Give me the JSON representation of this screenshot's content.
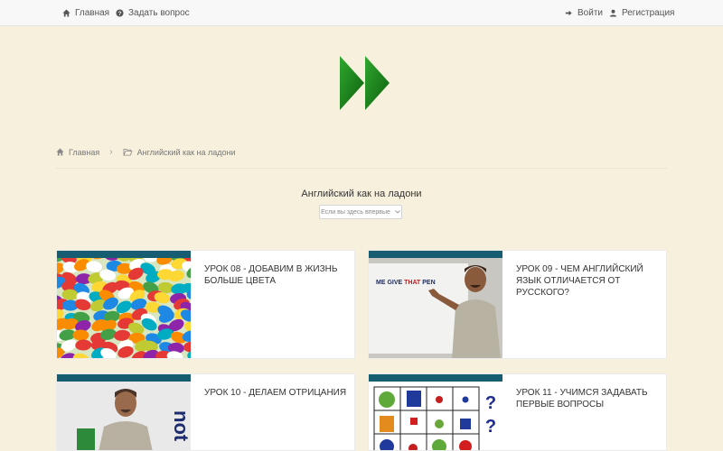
{
  "nav": {
    "home": "Главная",
    "ask": "Задать вопрос",
    "login": "Войти",
    "register": "Регистрация"
  },
  "breadcrumb": {
    "home": "Главная",
    "current": "Английский как на ладони"
  },
  "page": {
    "title": "Английский как на ладони",
    "select_value": "Если вы здесь впервые"
  },
  "lessons": [
    {
      "title": "Урок 08 - Добавим в жизнь больше цвета",
      "thumb": "colorful-candies"
    },
    {
      "title": "Урок 09 - Чем английский язык отличается от русского?",
      "thumb": "teacher-whiteboard",
      "thumb_text_parts": [
        "ME GIVE ",
        "THAT",
        " PEN"
      ]
    },
    {
      "title": "Урок 10 - Делаем отрицания",
      "thumb": "teacher-not",
      "thumb_text": "not"
    },
    {
      "title": "Урок 11 - Учимся задавать первые вопросы",
      "thumb": "question-grid",
      "thumb_text": "?"
    }
  ],
  "colors": {
    "background": "#f6f0dd",
    "accent_green": "#1e8a1e",
    "thumb_bar": "#175d72"
  }
}
